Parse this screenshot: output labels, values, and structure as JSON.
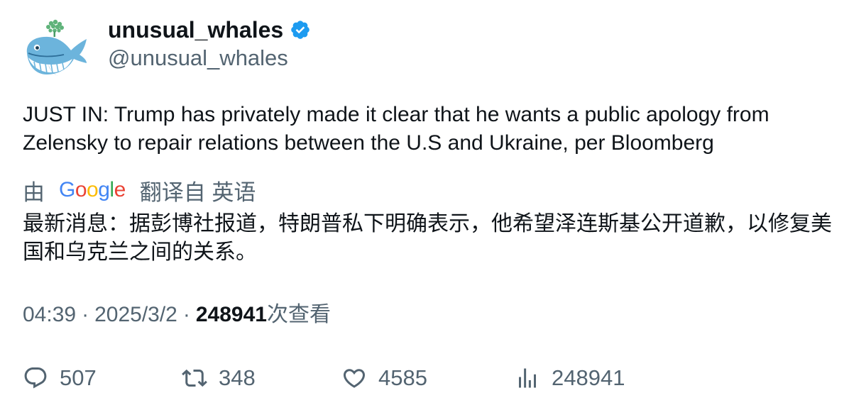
{
  "author": {
    "display_name": "unusual_whales",
    "handle": "@unusual_whales",
    "verified": true,
    "avatar_icon": "whale-avatar-icon",
    "badge_color": "#1d9bf0"
  },
  "tweet": {
    "text": "JUST IN: Trump has privately made it clear that he wants a public apology from Zelensky to repair relations between the U.S and Ukraine, per Bloomberg"
  },
  "translation": {
    "by_label": "由",
    "provider": "Google",
    "from_label": "翻译自 英语",
    "text": "最新消息：据彭博社报道，特朗普私下明确表示，他希望泽连斯基公开道歉，以修复美国和乌克兰之间的关系。"
  },
  "meta": {
    "time": "04:39",
    "separator": "·",
    "date": "2025/3/2",
    "views": "248941",
    "views_label": "次查看"
  },
  "actions": {
    "replies": "507",
    "retweets": "348",
    "likes": "4585",
    "views": "248941"
  },
  "colors": {
    "text": "#0f1419",
    "secondary": "#536471",
    "accent": "#1d9bf0"
  }
}
